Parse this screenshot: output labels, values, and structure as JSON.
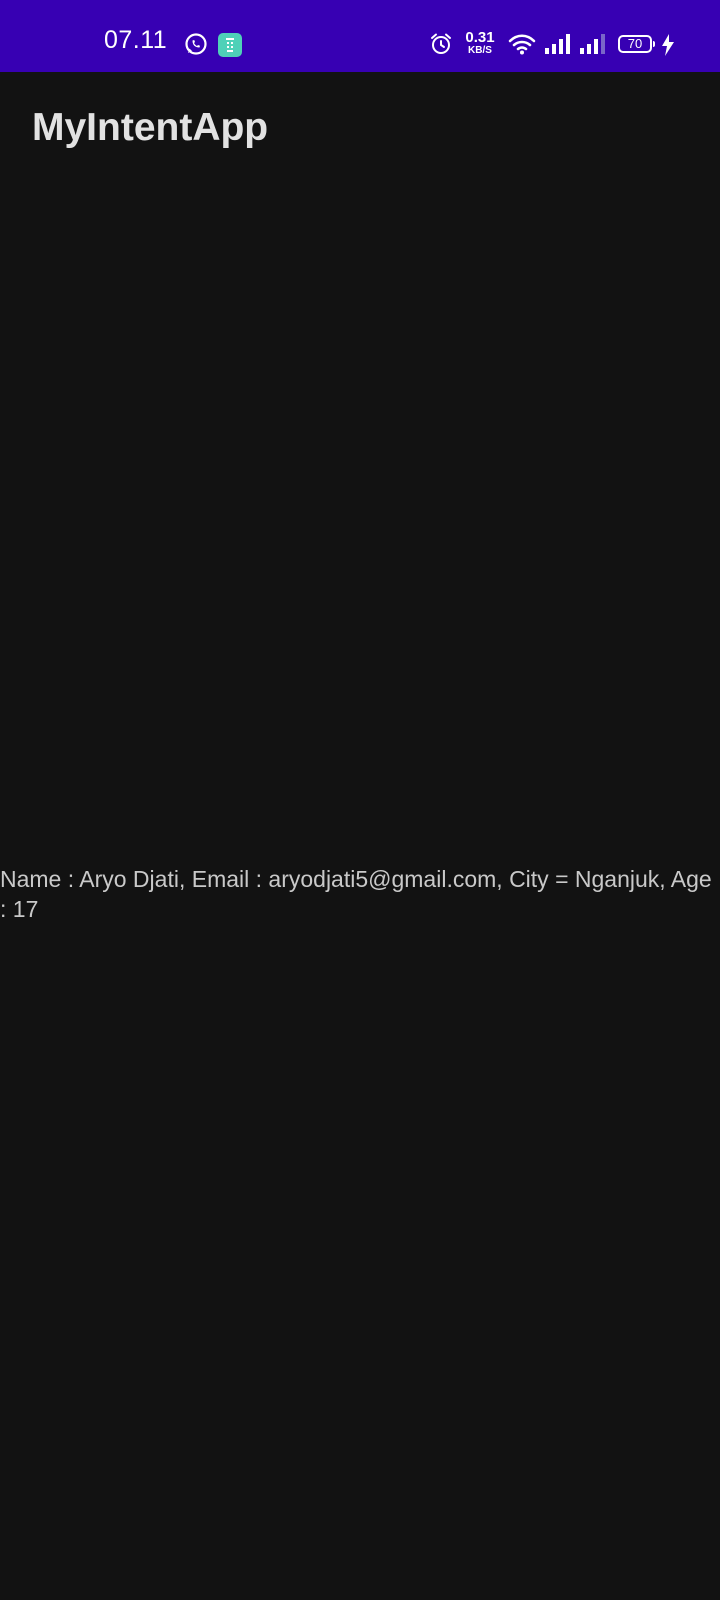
{
  "status_bar": {
    "time": "07.11",
    "network_speed_value": "0.31",
    "network_speed_unit": "KB/S",
    "battery_level": "70",
    "background_color": "#3700b3",
    "icons": [
      "whatsapp-icon",
      "app-notification-icon",
      "alarm-icon",
      "wifi-icon",
      "signal-icon",
      "signal-icon",
      "battery-icon",
      "charging-icon"
    ]
  },
  "app_bar": {
    "title": "MyIntentApp"
  },
  "main": {
    "detail_text": "Name : Aryo Djati, Email : aryodjati5@gmail.com, City =  Nganjuk, Age : 17"
  },
  "colors": {
    "background": "#121212",
    "title_text": "#e2e2e2",
    "body_text": "#c9c9c9"
  }
}
